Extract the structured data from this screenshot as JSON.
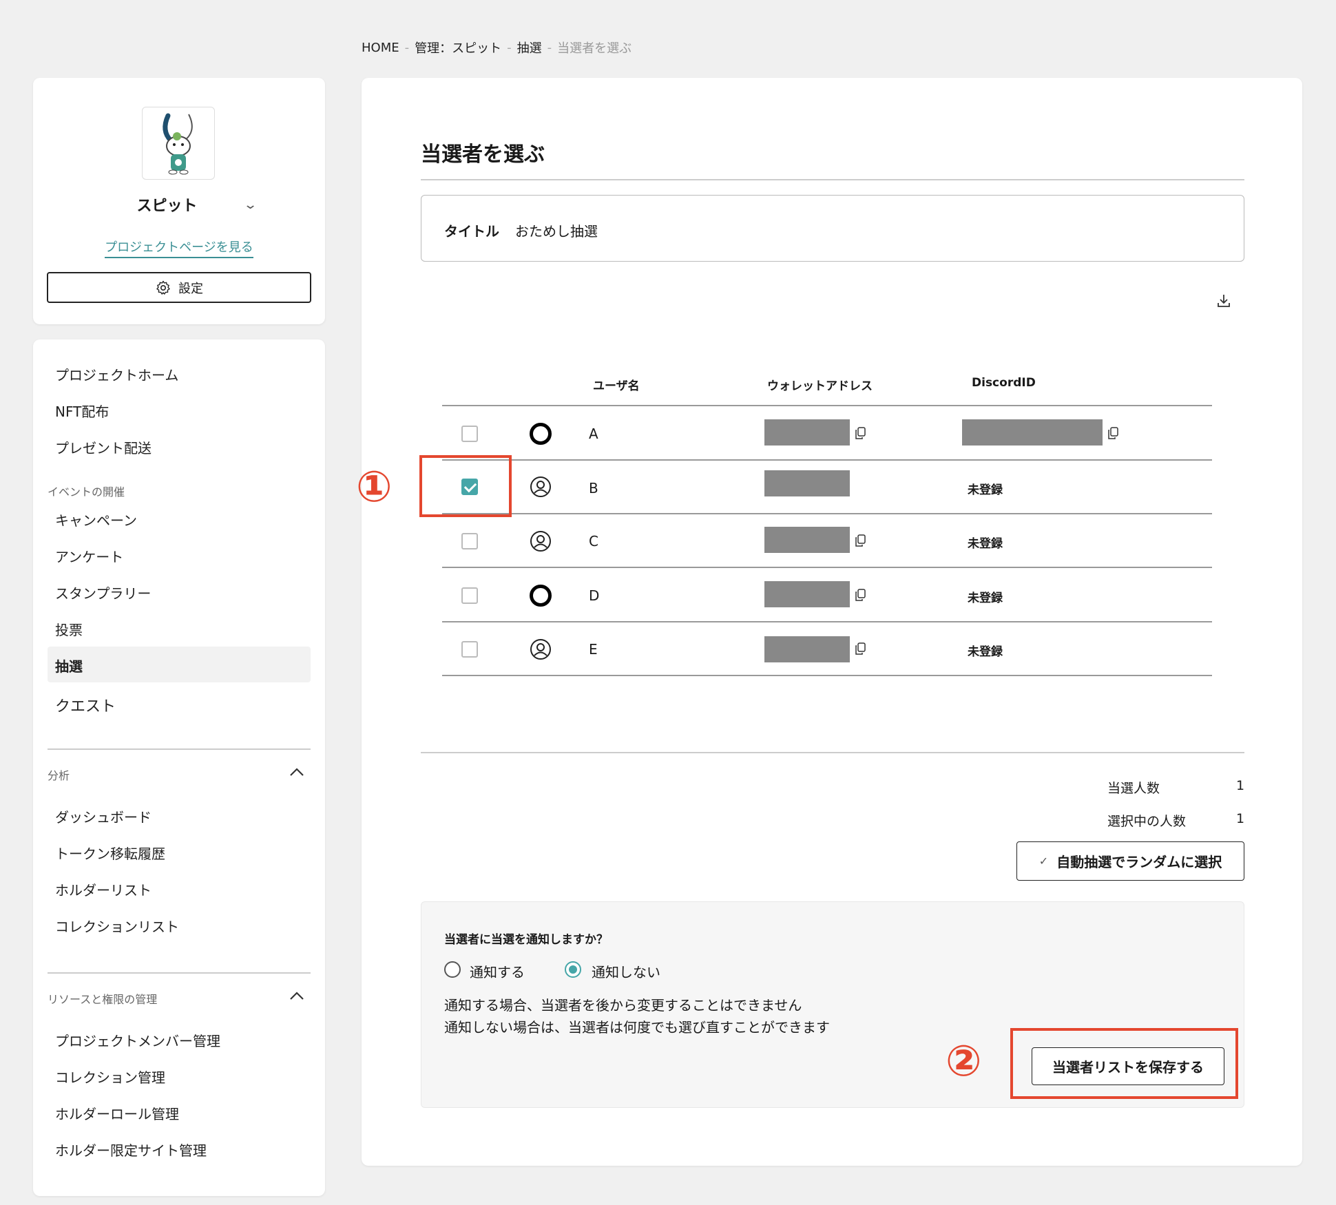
{
  "breadcrumb": {
    "items": [
      "HOME",
      "管理：スピット",
      "抽選"
    ],
    "current": "当選者を選ぶ",
    "sep": "-"
  },
  "project": {
    "name": "スピット",
    "link_label": "プロジェクトページを見る",
    "settings_label": "設定"
  },
  "nav": {
    "items_top": [
      "プロジェクトホーム",
      "NFT配布",
      "プレゼント配送"
    ],
    "event_section": "イベントの開催",
    "event_items": [
      "キャンペーン",
      "アンケート",
      "スタンプラリー",
      "投票",
      "抽選",
      "クエスト"
    ],
    "active_item": "抽選",
    "analytics_section": "分析",
    "analytics_items": [
      "ダッシュボード",
      "トークン移転履歴",
      "ホルダーリスト",
      "コレクションリスト"
    ],
    "resources_section": "リソースと権限の管理",
    "resources_items": [
      "プロジェクトメンバー管理",
      "コレクション管理",
      "ホルダーロール管理",
      "ホルダー限定サイト管理"
    ]
  },
  "main": {
    "page_title": "当選者を選ぶ",
    "title_label": "タイトル",
    "title_value": "おためし抽選",
    "table": {
      "headers": [
        "ユーザ名",
        "ウォレットアドレス",
        "DiscordID"
      ],
      "rows": [
        {
          "checked": false,
          "avatar": "ring-icon",
          "name": "A",
          "wallet_copy": true,
          "discord": "",
          "discord_redacted": true
        },
        {
          "checked": true,
          "avatar": "user-circle-icon",
          "name": "B",
          "wallet_copy": false,
          "discord": "未登録",
          "discord_redacted": false
        },
        {
          "checked": false,
          "avatar": "user-circle-icon",
          "name": "C",
          "wallet_copy": true,
          "discord": "未登録",
          "discord_redacted": false
        },
        {
          "checked": false,
          "avatar": "ring-icon",
          "name": "D",
          "wallet_copy": true,
          "discord": "未登録",
          "discord_redacted": false
        },
        {
          "checked": false,
          "avatar": "user-circle-icon",
          "name": "E",
          "wallet_copy": true,
          "discord": "未登録",
          "discord_redacted": false
        }
      ]
    },
    "winners_label": "当選人数",
    "winners_value": "1",
    "selected_label": "選択中の人数",
    "selected_value": "1",
    "auto_select_label": "自動抽選でランダムに選択",
    "notify": {
      "question": "当選者に当選を通知しますか？",
      "option_yes": "通知する",
      "option_no": "通知しない",
      "selected": "通知しない",
      "note_1": "通知する場合、当選者を後から変更することはできません",
      "note_2": "通知しない場合は、当選者は何度でも選び直すことができます",
      "save_label": "当選者リストを保存する"
    }
  },
  "annotations": {
    "one": "①",
    "two": "②"
  },
  "colors": {
    "accent": "#46a6a8",
    "link": "#3a8f94",
    "annotation": "#e4472f"
  }
}
